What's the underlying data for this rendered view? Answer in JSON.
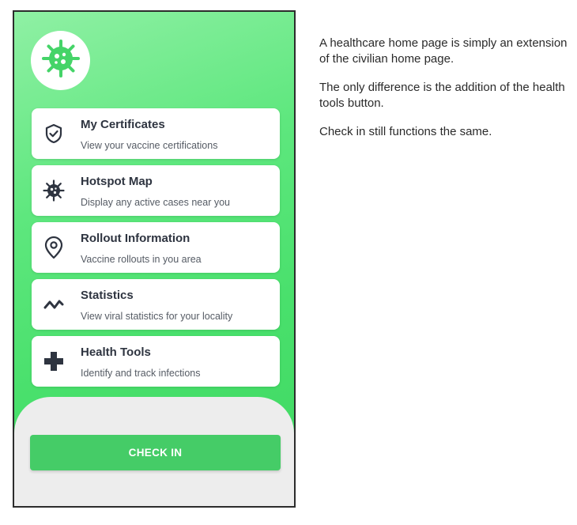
{
  "app": {
    "logo_icon": "virus-icon",
    "accent_color": "#45cc67"
  },
  "menu": {
    "items": [
      {
        "title": "My Certificates",
        "subtitle": "View your vaccine certifications",
        "icon": "shield-check-icon"
      },
      {
        "title": "Hotspot Map",
        "subtitle": "Display any active cases near you",
        "icon": "virus-icon"
      },
      {
        "title": "Rollout Information",
        "subtitle": "Vaccine rollouts in you area",
        "icon": "location-pin-icon"
      },
      {
        "title": "Statistics",
        "subtitle": "View viral statistics for your locality",
        "icon": "trend-line-icon"
      },
      {
        "title": "Health Tools",
        "subtitle": "Identify and track infections",
        "icon": "plus-cross-icon"
      }
    ]
  },
  "check_in": {
    "label": "CHECK IN"
  },
  "description": {
    "paragraphs": [
      "A healthcare home page is simply an extension of the civilian home page.",
      "The only difference is the addition of the health tools button.",
      "Check in still functions the same."
    ]
  }
}
